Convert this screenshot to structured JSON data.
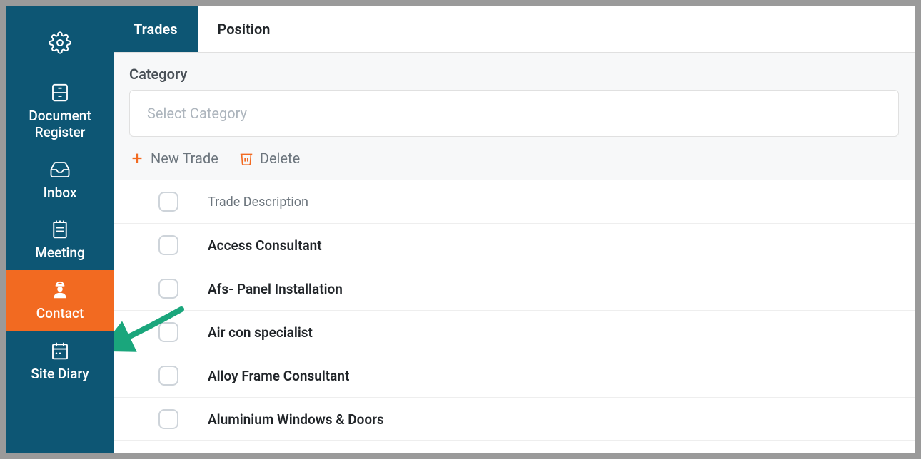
{
  "sidebar": {
    "items": [
      {
        "label": "",
        "icon": "gear"
      },
      {
        "label": "Document Register",
        "icon": "file-cabinet"
      },
      {
        "label": "Inbox",
        "icon": "inbox"
      },
      {
        "label": "Meeting",
        "icon": "notepad"
      },
      {
        "label": "Contact",
        "icon": "worker",
        "active": true
      },
      {
        "label": "Site Diary",
        "icon": "calendar"
      }
    ]
  },
  "tabs": [
    {
      "label": "Trades",
      "active": true
    },
    {
      "label": "Position",
      "active": false
    }
  ],
  "filter": {
    "label": "Category",
    "placeholder": "Select Category"
  },
  "actions": {
    "new_trade": "New Trade",
    "delete": "Delete"
  },
  "table": {
    "header": "Trade Description",
    "rows": [
      {
        "label": "Access Consultant"
      },
      {
        "label": "Afs- Panel Installation"
      },
      {
        "label": "Air con specialist"
      },
      {
        "label": "Alloy Frame Consultant"
      },
      {
        "label": "Aluminium Windows & Doors"
      }
    ]
  },
  "colors": {
    "sidebar_bg": "#0d5674",
    "active_bg": "#f26a21",
    "accent": "#f26a21",
    "arrow": "#1aa67c"
  }
}
